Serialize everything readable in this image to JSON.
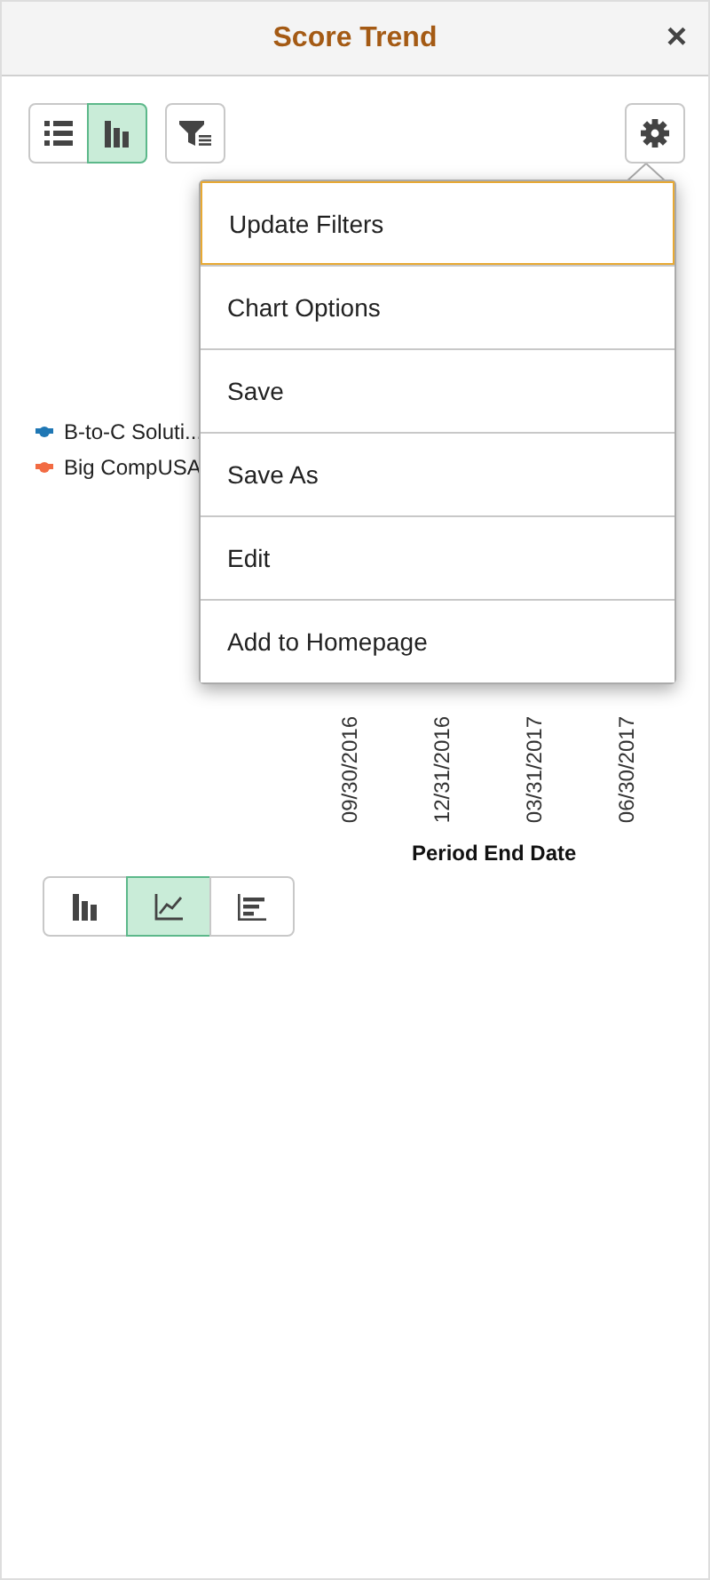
{
  "header": {
    "title": "Score Trend",
    "close": "×"
  },
  "view_toggle": [
    {
      "kind": "list",
      "selected": false
    },
    {
      "kind": "chart",
      "selected": true
    }
  ],
  "legend": [
    {
      "label": "B-to-C Soluti...",
      "color": "#1f77b4"
    },
    {
      "label": "Big CompUSA",
      "color": "#f26b43"
    }
  ],
  "x_axis": {
    "labels": [
      "09/30/2016",
      "12/31/2016",
      "03/31/2017",
      "06/30/2017"
    ],
    "title": "Period End Date"
  },
  "menu": {
    "items": [
      {
        "label": "Update Filters",
        "selected": true
      },
      {
        "label": "Chart Options",
        "selected": false
      },
      {
        "label": "Save",
        "selected": false
      },
      {
        "label": "Save As",
        "selected": false
      },
      {
        "label": "Edit",
        "selected": false
      },
      {
        "label": "Add to Homepage",
        "selected": false
      }
    ]
  },
  "chart_types": [
    {
      "kind": "bar",
      "selected": false
    },
    {
      "kind": "line",
      "selected": true
    },
    {
      "kind": "hbar",
      "selected": false
    }
  ]
}
